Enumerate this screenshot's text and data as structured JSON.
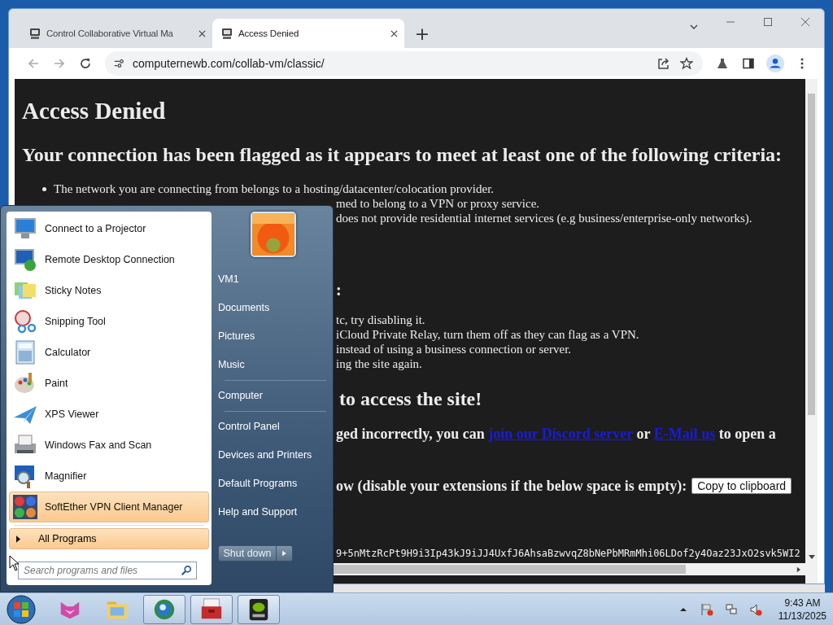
{
  "browser": {
    "tabs": [
      {
        "title": "Control Collaborative Virtual Ma",
        "selected": false
      },
      {
        "title": "Access Denied",
        "selected": true
      }
    ],
    "new_tab": "+",
    "address": "computernewb.com/collab-vm/classic/",
    "page": {
      "heading": "Access Denied",
      "criteria_heading": "Your connection has been flagged as it appears to meet at least one of the following criteria:",
      "criteria": [
        {
          "kind": "item",
          "text": "The network you are connecting from belongs to a hosting/datacenter/colocation provider."
        },
        {
          "kind": "fragment",
          "text": "med to belong to a VPN or proxy service."
        },
        {
          "kind": "fragment",
          "text": "does not provide residential internet services (e.g business/enterprise-only networks)."
        }
      ],
      "tips_heading_end": ":",
      "tips": [
        "tc, try disabling it.",
        "iCloud Private Relay, turn them off as they can flag as a VPN.",
        "instead of using a business connection or server.",
        "ing the site again."
      ],
      "access_heading_end": "to access the site!",
      "contact": {
        "before": "ged incorrectly, you can",
        "link_1": "join our Discord server",
        "middle": "or",
        "link_2": "E-Mail us",
        "after": "to open a"
      },
      "code_prompt": "ow (disable your extensions if the below space is empty):",
      "copy_button": "Copy to clipboard",
      "code": "9+5nMtzRcPt9H9i3Ip43kJ9iJJ4UxfJ6AhsaBzwvqZ8bNePbMRmMhi06LDof2y4Oaz23JxO2svk5WI2"
    }
  },
  "start_menu": {
    "programs": [
      {
        "label": "Connect to a Projector",
        "highlighted": false
      },
      {
        "label": "Remote Desktop Connection",
        "highlighted": false
      },
      {
        "label": "Sticky Notes",
        "highlighted": false
      },
      {
        "label": "Snipping Tool",
        "highlighted": false
      },
      {
        "label": "Calculator",
        "highlighted": false
      },
      {
        "label": "Paint",
        "highlighted": false
      },
      {
        "label": "XPS Viewer",
        "highlighted": false
      },
      {
        "label": "Windows Fax and Scan",
        "highlighted": false
      },
      {
        "label": "Magnifier",
        "highlighted": false
      },
      {
        "label": "SoftEther VPN Client Manager",
        "highlighted": true
      }
    ],
    "all_programs": {
      "label": "All Programs",
      "highlighted": true
    },
    "search": {
      "placeholder": "Search programs and files"
    },
    "places": [
      [
        "VM1",
        "Documents",
        "Pictures",
        "Music"
      ],
      [
        "Computer"
      ],
      [
        "Control Panel",
        "Devices and Printers",
        "Default Programs",
        "Help and Support"
      ]
    ],
    "shutdown": "Shut down"
  },
  "taskbar": {
    "apps": [
      {
        "active": false
      },
      {
        "active": false
      },
      {
        "active": true
      },
      {
        "active": true
      },
      {
        "active": true
      }
    ],
    "clock": {
      "time": "9:43 AM",
      "date": "11/13/2025"
    }
  }
}
